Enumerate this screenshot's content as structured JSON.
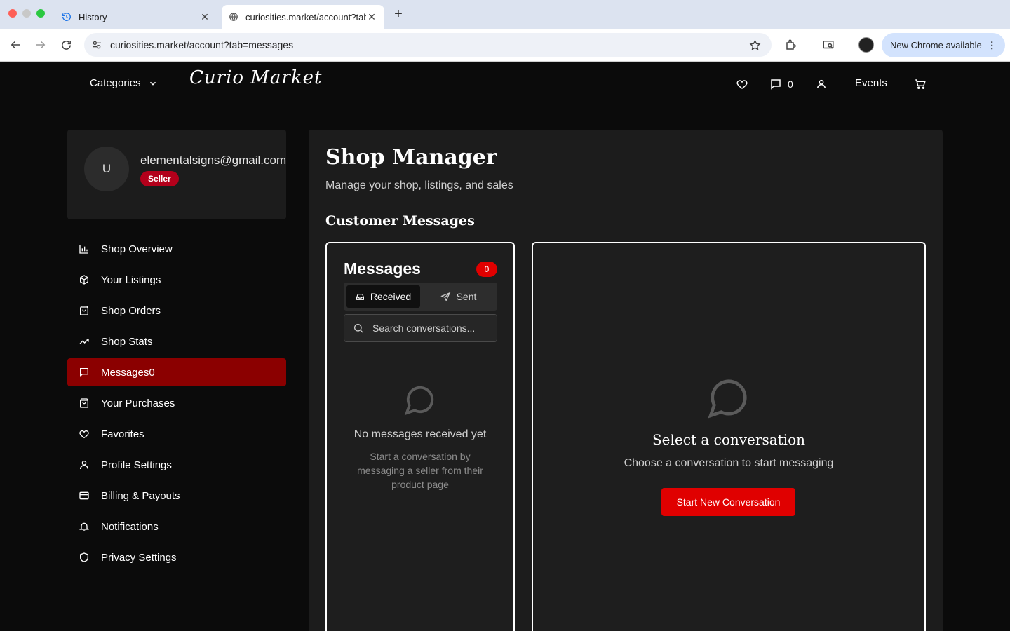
{
  "browser": {
    "tabs": [
      {
        "title": "History",
        "icon": "history-icon"
      },
      {
        "title": "curiosities.market/account?tab=messages",
        "icon": "globe-icon"
      }
    ],
    "url": "curiosities.market/account?tab=messages",
    "update_label": "New Chrome available"
  },
  "header": {
    "categories_label": "Categories",
    "logo_text": "Curio Market",
    "messages_count": "0",
    "events_label": "Events"
  },
  "profile": {
    "avatar_initial": "U",
    "email": "elementalsigns@gmail.com",
    "role_badge": "Seller"
  },
  "sidebar": {
    "items": [
      {
        "label": "Shop Overview",
        "icon": "bar-chart-icon"
      },
      {
        "label": "Your Listings",
        "icon": "package-icon"
      },
      {
        "label": "Shop Orders",
        "icon": "shopping-bag-icon"
      },
      {
        "label": "Shop Stats",
        "icon": "trending-up-icon"
      },
      {
        "label": "Messages0",
        "icon": "message-icon",
        "active": true
      },
      {
        "label": "Your Purchases",
        "icon": "shopping-bag-icon"
      },
      {
        "label": "Favorites",
        "icon": "heart-icon"
      },
      {
        "label": "Profile Settings",
        "icon": "user-icon"
      },
      {
        "label": "Billing & Payouts",
        "icon": "credit-card-icon"
      },
      {
        "label": "Notifications",
        "icon": "bell-icon"
      },
      {
        "label": "Privacy Settings",
        "icon": "shield-icon"
      }
    ]
  },
  "main": {
    "title": "Shop Manager",
    "subtitle": "Manage your shop, listings, and sales",
    "section_title": "Customer Messages",
    "messages": {
      "heading": "Messages",
      "count": "0",
      "tab_received": "Received",
      "tab_sent": "Sent",
      "search_placeholder": "Search conversations...",
      "empty_title": "No messages received yet",
      "empty_desc": "Start a conversation by messaging a seller from their product page"
    },
    "conversation": {
      "title": "Select a conversation",
      "subtitle": "Choose a conversation to start messaging",
      "button_label": "Start New Conversation"
    }
  },
  "colors": {
    "accent_red": "#e00000",
    "active_nav": "#8b0000",
    "badge_red": "#b3001b",
    "panel_bg": "#1c1c1c",
    "page_bg": "#0b0b0b"
  }
}
